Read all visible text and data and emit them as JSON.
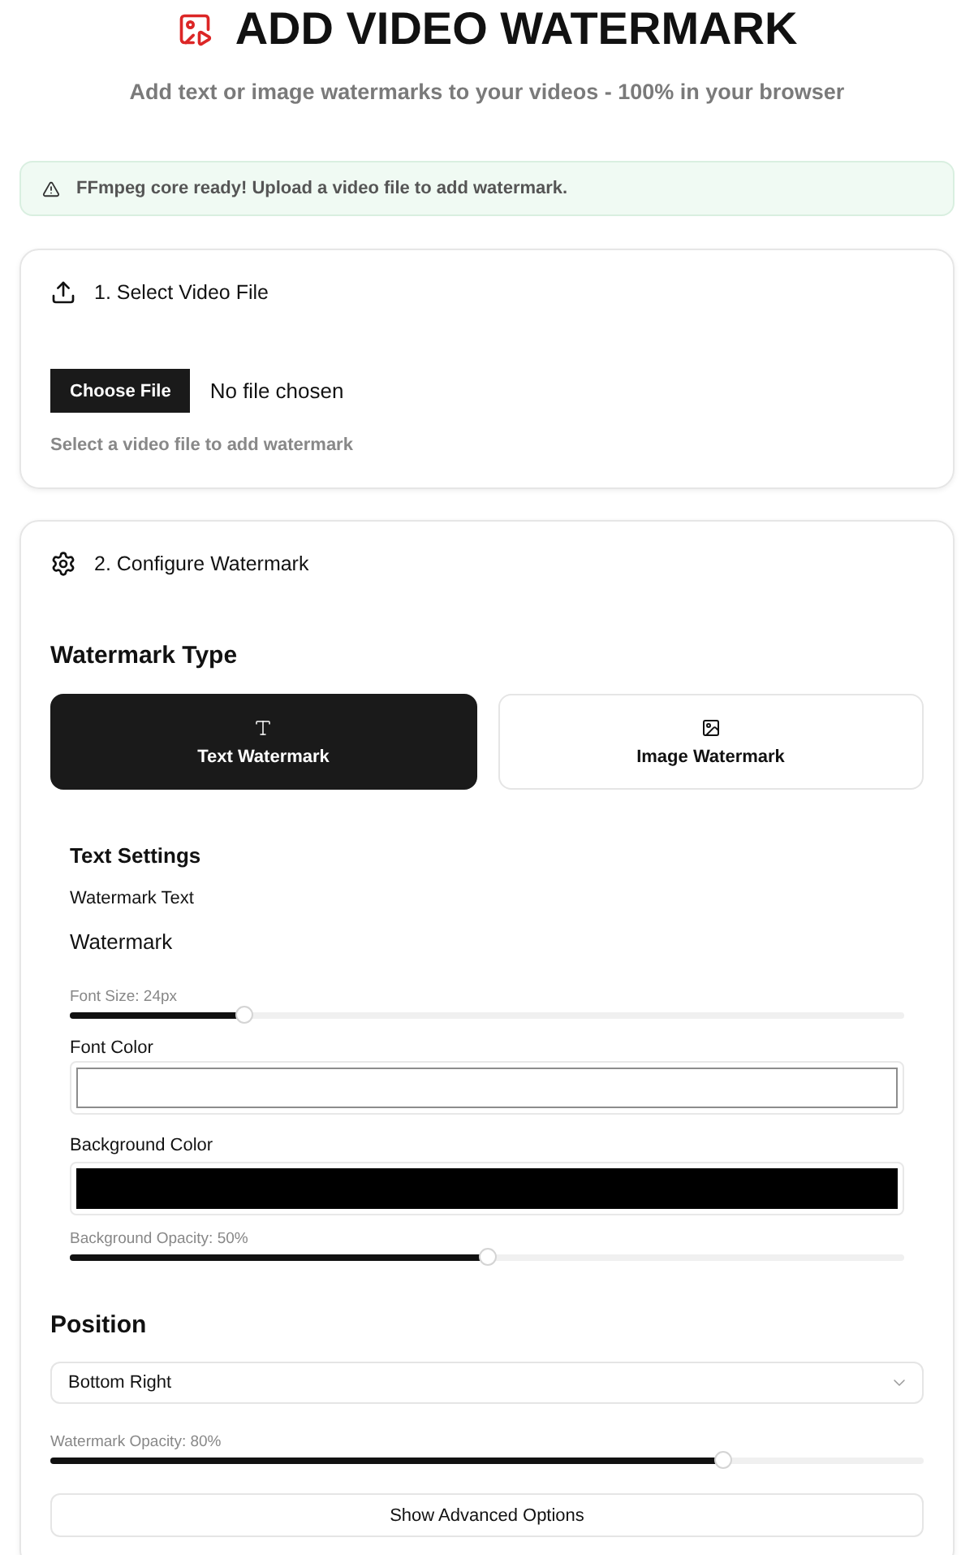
{
  "header": {
    "title": "ADD VIDEO WATERMARK",
    "subtitle": "Add text or image watermarks to your videos - 100% in your browser"
  },
  "alert": {
    "text": "FFmpeg core ready! Upload a video file to add watermark."
  },
  "file_card": {
    "title": "1. Select Video File",
    "button": "Choose File",
    "file_status": "No file chosen",
    "hint": "Select a video file to add watermark"
  },
  "config_card": {
    "title": "2. Configure Watermark",
    "type_heading": "Watermark Type",
    "types": [
      {
        "kind": "text",
        "label": "Text Watermark",
        "selected": true
      },
      {
        "kind": "image",
        "label": "Image Watermark",
        "selected": false
      }
    ],
    "text_settings": {
      "heading": "Text Settings",
      "text_label": "Watermark Text",
      "text_value": "Watermark",
      "font_size": {
        "label": "Font Size: 24px",
        "level": 0.21
      },
      "font_color": {
        "label": "Font Color",
        "color": "#ffffff"
      },
      "background_color": {
        "label": "Background Color",
        "color": "#000000"
      },
      "background_opacity": {
        "label": "Background Opacity: 50%",
        "level": 0.5
      }
    },
    "position": {
      "heading": "Position",
      "value": "Bottom Right"
    },
    "watermark_opacity": {
      "label": "Watermark Opacity: 80%",
      "level": 0.77
    },
    "advanced_button": "Show Advanced Options"
  }
}
